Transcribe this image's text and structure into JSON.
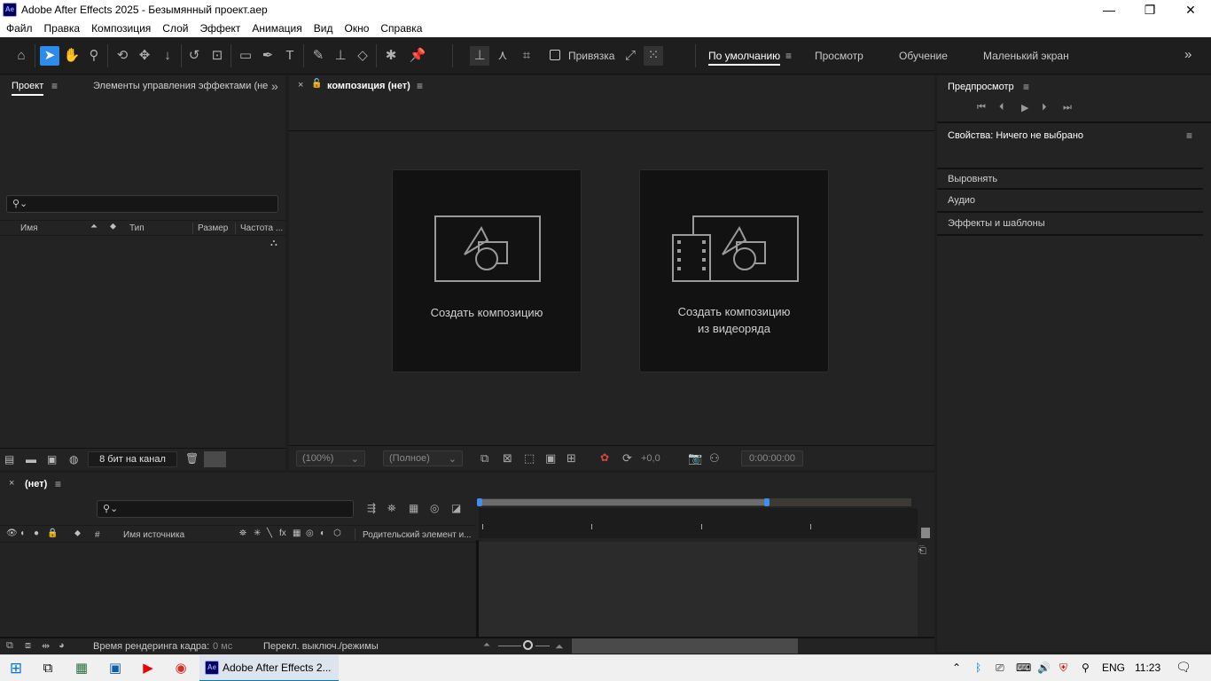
{
  "window": {
    "app_icon": "Ae",
    "title": "Adobe After Effects 2025 - Безымянный проект.aep",
    "min": "—",
    "restore": "❐",
    "close": "✕"
  },
  "menu": [
    "Файл",
    "Правка",
    "Композиция",
    "Слой",
    "Эффект",
    "Анимация",
    "Вид",
    "Окно",
    "Справка"
  ],
  "toolbar": {
    "snap_label": "Привязка",
    "workspaces": [
      "По умолчанию",
      "Просмотр",
      "Обучение",
      "Маленький экран"
    ],
    "more": "»"
  },
  "project": {
    "tab_project": "Проект",
    "tab_effects": "Элементы управления эффектами (нет",
    "columns": [
      "Имя",
      "Тип",
      "Размер",
      "Частота ..."
    ],
    "bit_depth": "8 бит на канал"
  },
  "composition": {
    "tab_title": "композиция (нет)",
    "card1": "Создать композицию",
    "card2_line1": "Создать композицию",
    "card2_line2": "из видеоряда",
    "zoom": "(100%)",
    "resolution": "(Полное)",
    "exposure": "+0,0",
    "timecode": "0:00:00:00"
  },
  "right": {
    "preview_title": "Предпросмотр",
    "properties_title": "Свойства: Ничего не выбрано",
    "sections": [
      "Выровнять",
      "Аудио",
      "Эффекты и шаблоны"
    ]
  },
  "timeline": {
    "tab_title": "(нет)",
    "col_hash": "#",
    "col_source": "Имя источника",
    "col_parent": "Родительский элемент и...",
    "render_time_label": "Время рендеринга кадра:",
    "render_time_value": "0 мс",
    "toggle_label": "Перекл. выключ./режимы"
  },
  "taskbar": {
    "app_label": "Adobe After Effects 2...",
    "lang": "ENG",
    "time": "11:23"
  },
  "colors": {
    "accent": "#2d8ceb",
    "ae_bg": "#00005b",
    "ae_fg": "#9999ff"
  }
}
